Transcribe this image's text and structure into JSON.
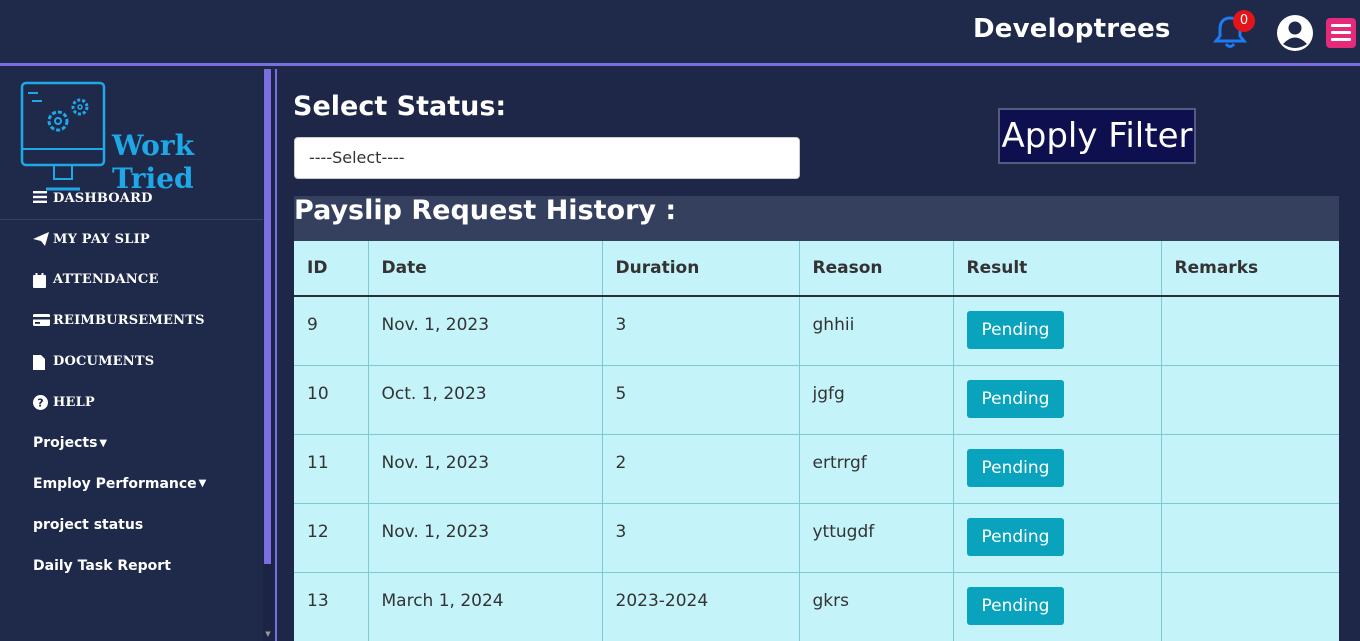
{
  "header": {
    "brand": "Developtrees",
    "notification_count": "0"
  },
  "logo": {
    "text": "Work Tried"
  },
  "sidebar": {
    "items": [
      {
        "label": "DASHBOARD",
        "icon": "bars-icon"
      },
      {
        "label": "MY PAY SLIP",
        "icon": "paper-plane-icon"
      },
      {
        "label": "ATTENDANCE",
        "icon": "calendar-icon"
      },
      {
        "label": "REIMBURSEMENTS",
        "icon": "credit-card-icon"
      },
      {
        "label": "DOCUMENTS",
        "icon": "file-icon"
      },
      {
        "label": "HELP",
        "icon": "question-circle-icon"
      },
      {
        "label": "Projects"
      },
      {
        "label": "Employ Performance"
      },
      {
        "label": "project status"
      },
      {
        "label": "Daily Task Report"
      }
    ]
  },
  "filter": {
    "label": "Select Status:",
    "selected": "----Select----",
    "apply_label": "Apply Filter"
  },
  "history": {
    "title": "Payslip Request History :",
    "columns": [
      "ID",
      "Date",
      "Duration",
      "Reason",
      "Result",
      "Remarks"
    ],
    "rows": [
      {
        "id": "9",
        "date": "Nov. 1, 2023",
        "duration": "3",
        "reason": "ghhii",
        "result": "Pending",
        "remarks": ""
      },
      {
        "id": "10",
        "date": "Oct. 1, 2023",
        "duration": "5",
        "reason": "jgfg",
        "result": "Pending",
        "remarks": ""
      },
      {
        "id": "11",
        "date": "Nov. 1, 2023",
        "duration": "2",
        "reason": "ertrrgf",
        "result": "Pending",
        "remarks": ""
      },
      {
        "id": "12",
        "date": "Nov. 1, 2023",
        "duration": "3",
        "reason": "yttugdf",
        "result": "Pending",
        "remarks": ""
      },
      {
        "id": "13",
        "date": "March 1, 2024",
        "duration": "2023-2024",
        "reason": "gkrs",
        "result": "Pending",
        "remarks": ""
      }
    ]
  },
  "colors": {
    "accent": "#7b6fe0",
    "badge": "#e3151a",
    "pending": "#09a3bd",
    "table_bg": "#c4f3f9"
  }
}
